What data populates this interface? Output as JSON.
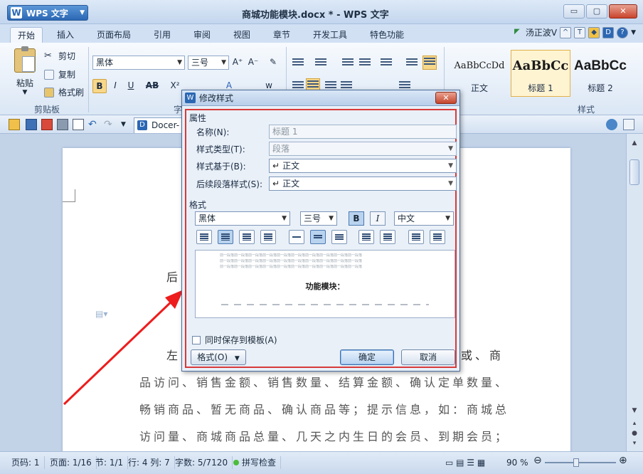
{
  "app": {
    "menu_label": "WPS 文字",
    "window_title": "商城功能模块.docx * - WPS 文字",
    "win_buttons": [
      "▭",
      "▢",
      "✕"
    ]
  },
  "tabs": [
    "开始",
    "插入",
    "页面布局",
    "引用",
    "审阅",
    "视图",
    "章节",
    "开发工具",
    "特色功能"
  ],
  "user": {
    "name": "汤正波V"
  },
  "ribbon": {
    "clipboard": {
      "paste": "粘贴",
      "cut": "剪切",
      "copy": "复制",
      "format_painter": "格式刷",
      "group": "剪贴板"
    },
    "font": {
      "name": "黑体",
      "size": "三号",
      "group": "字"
    },
    "styles": {
      "group": "样式",
      "items": [
        {
          "sample": "AaBbCcDd",
          "name": "正文"
        },
        {
          "sample": "AaBbCc",
          "name": "标题 1"
        },
        {
          "sample": "AaBbCc",
          "name": "标题 2"
        }
      ]
    }
  },
  "quick": {
    "doc_tab": "Docer-"
  },
  "document": {
    "lines": [
      "后",
      "左",
      "品访问、销售金额、销售数量、结算金额、确认定单数量、",
      "畅销商品、暂无商品、确认商品等；提示信息，如：商城总",
      "访问量、商城商品总量、几天之内生日的会员、到期会员；"
    ],
    "right_fragment": "或、商"
  },
  "status": {
    "page_code": "页码: 1",
    "page": "页面: 1/16",
    "section": "节: 1/1",
    "row_col": "行: 4  列: 7",
    "word_count": "字数: 5/7120",
    "spell": "拼写检查",
    "zoom": "90 %"
  },
  "dialog": {
    "title": "修改样式",
    "close": "✕",
    "properties_label": "属性",
    "fields": [
      {
        "label": "名称(N):",
        "value": "标题 1"
      },
      {
        "label": "样式类型(T):",
        "value": "段落"
      },
      {
        "label": "样式基于(B):",
        "value": "正文"
      },
      {
        "label": "后续段落样式(S):",
        "value": "正文"
      }
    ],
    "format_label": "格式",
    "font": "黑体",
    "size": "三号",
    "bold": "B",
    "italic": "I",
    "script": "中文",
    "preview": {
      "prev_text": "前一段落前一段落前一段落前一段落前一段落前一段落前一段落前一段落前一段落前一段落",
      "title": "功能模块："
    },
    "save_template": "同时保存到模板(A)",
    "format_button": "格式(O)",
    "ok": "确定",
    "cancel": "取消"
  }
}
